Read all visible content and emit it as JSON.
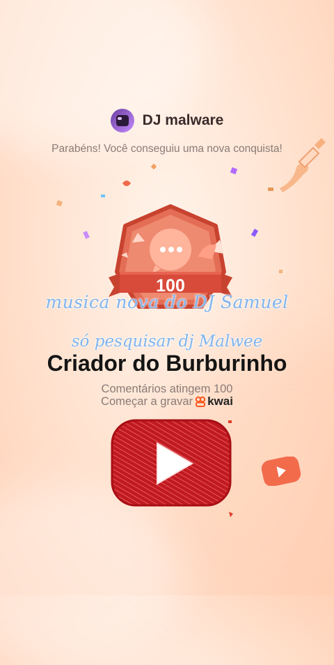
{
  "profile": {
    "username": "DJ malware"
  },
  "congrats_text": "Parabéns! Você conseguiu uma nova conquista!",
  "badge": {
    "value": "100"
  },
  "overlay": {
    "line1": "musica nova do DJ Samuel",
    "line2": "só pesquisar dj Malwee"
  },
  "achievement": {
    "title": "Criador do Burburinho",
    "description": "Comentários atingem 100",
    "cta": "Começar a gravar",
    "brand": "kwai"
  },
  "colors": {
    "badge_red": "#d84a3a",
    "accent_orange": "#ff5a1f",
    "overlay_blue": "#7fb4ee"
  }
}
